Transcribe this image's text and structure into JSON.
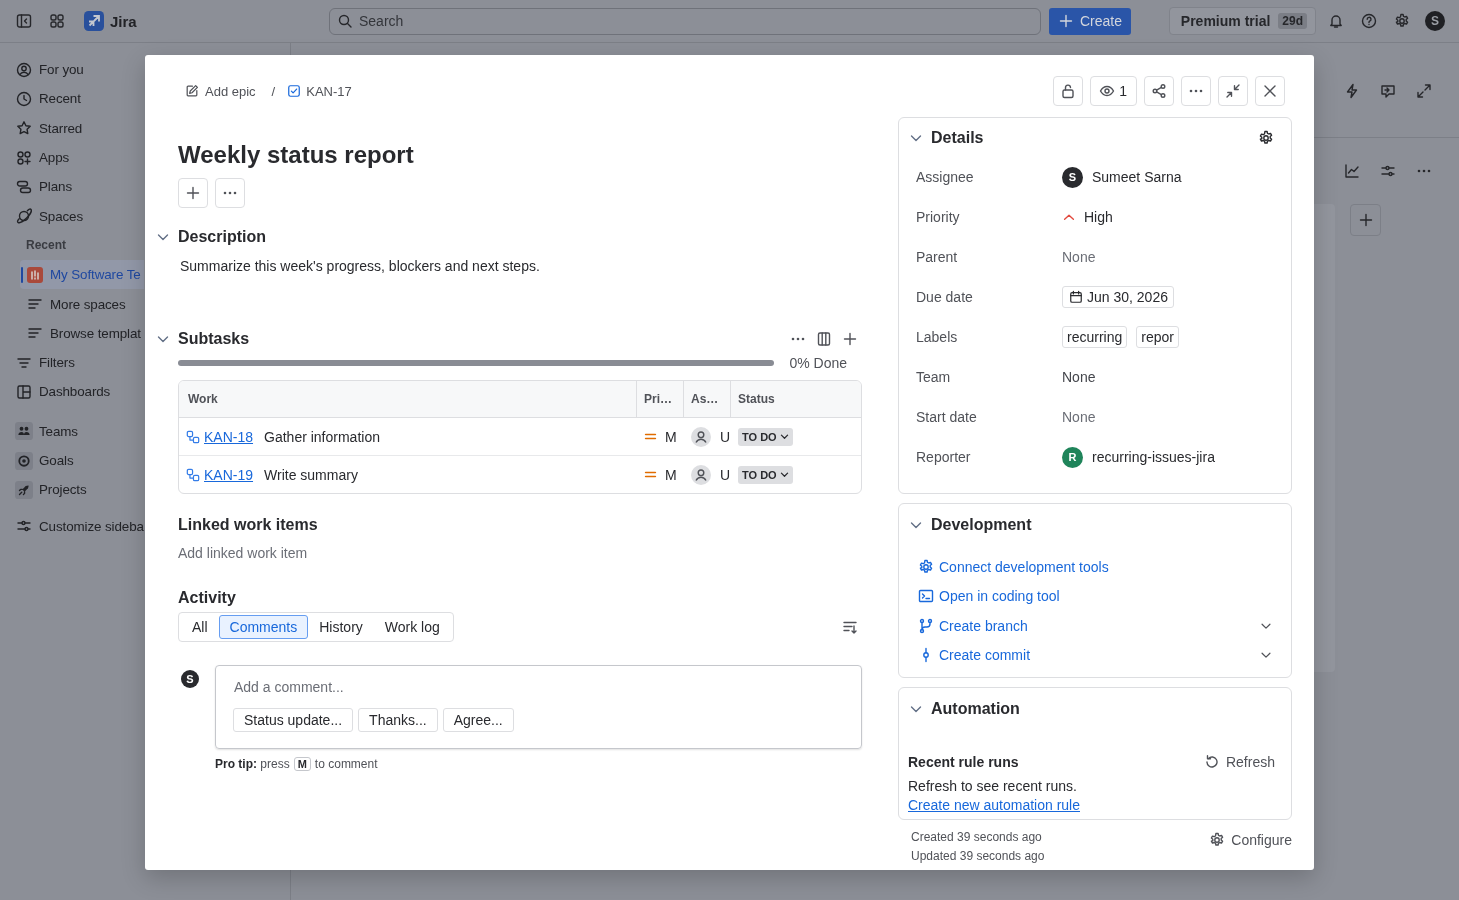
{
  "topbar": {
    "product": "Jira",
    "search": {
      "placeholder": "Search"
    },
    "create_button": "Create",
    "trial": {
      "label": "Premium trial",
      "badge": "29d"
    },
    "avatar": "S"
  },
  "sidebar": {
    "items": [
      {
        "label": "For you",
        "kind": "nav",
        "selected": false
      },
      {
        "label": "Recent",
        "kind": "nav",
        "selected": false
      },
      {
        "label": "Starred",
        "kind": "nav",
        "selected": false
      },
      {
        "label": "Apps",
        "kind": "nav",
        "selected": false
      },
      {
        "label": "Plans",
        "kind": "nav",
        "selected": false
      },
      {
        "label": "Spaces",
        "kind": "nav",
        "selected": false
      },
      {
        "label": "Recent",
        "kind": "section",
        "selected": false
      },
      {
        "label": "My Software Te",
        "kind": "project",
        "selected": true
      },
      {
        "label": "More spaces",
        "kind": "sub",
        "selected": false
      },
      {
        "label": "Browse templat",
        "kind": "sub",
        "selected": false
      },
      {
        "label": "Filters",
        "kind": "nav",
        "selected": false
      },
      {
        "label": "Dashboards",
        "kind": "nav",
        "selected": false
      },
      {
        "label": "Teams",
        "kind": "tile",
        "selected": false
      },
      {
        "label": "Goals",
        "kind": "tile",
        "selected": false
      },
      {
        "label": "Projects",
        "kind": "tile",
        "selected": false
      },
      {
        "label": "Customize sideba",
        "kind": "nav",
        "selected": false
      }
    ]
  },
  "modal": {
    "breadcrumbs": [
      {
        "label": "Add epic",
        "kind": "epic"
      },
      {
        "label": "KAN-17",
        "kind": "task"
      }
    ],
    "breadcrumb_separator": "/",
    "watchers": "1",
    "title": "Weekly status report",
    "description": {
      "heading": "Description",
      "expanded": true,
      "text": "Summarize this week's progress, blockers and next steps."
    },
    "subtasks": {
      "heading": "Subtasks",
      "expanded": true,
      "level": 0,
      "progress_label": "0% Done",
      "columns": [
        "Work",
        "Pri…",
        "As…",
        "Status"
      ],
      "rows": [
        {
          "key": "KAN-18",
          "summary": "Gather information",
          "priority": "M",
          "assignee": "U",
          "status": "TO DO"
        },
        {
          "key": "KAN-19",
          "summary": "Write summary",
          "priority": "M",
          "assignee": "U",
          "status": "TO DO"
        }
      ]
    },
    "linked_work_items": {
      "heading": "Linked work items",
      "action": "Add linked work item"
    },
    "activity": {
      "heading": "Activity",
      "tabs": [
        {
          "label": "All",
          "selected": false
        },
        {
          "label": "Comments",
          "selected": true
        },
        {
          "label": "History",
          "selected": false
        },
        {
          "label": "Work log",
          "selected": false
        }
      ],
      "avatar": "S",
      "comment_placeholder": "Add a comment...",
      "suggestions": [
        "Status update...",
        "Thanks...",
        "Agree..."
      ],
      "pro_tip": "**Pro tip:** press",
      "shortcut_key": "M",
      "pro_tip_end": "to comment"
    },
    "details": {
      "heading": "Details",
      "expanded": true,
      "fields": [
        {
          "label": "Assignee",
          "kind": "person",
          "avatar": "S",
          "color": "#292a2e",
          "value": "Sumeet Sarna"
        },
        {
          "label": "Priority",
          "kind": "priority",
          "value": "High"
        },
        {
          "label": "Parent",
          "kind": "empty",
          "value": "None"
        },
        {
          "label": "Due date",
          "kind": "date",
          "value": "Jun 30, 2026"
        },
        {
          "label": "Labels",
          "kind": "labels",
          "values": [
            "recurring",
            "repor"
          ]
        },
        {
          "label": "Team",
          "kind": "text",
          "value": "None"
        },
        {
          "label": "Start date",
          "kind": "empty",
          "value": "None"
        },
        {
          "label": "Reporter",
          "kind": "person",
          "avatar": "R",
          "color": "#1f845a",
          "value": "recurring-issues-jira"
        }
      ]
    },
    "development": {
      "heading": "Development",
      "expanded": true,
      "links": [
        {
          "label": "Connect development tools",
          "kind": "connect",
          "expandable": false
        },
        {
          "label": "Open in coding tool",
          "kind": "code",
          "expandable": false
        },
        {
          "label": "Create branch",
          "kind": "branch",
          "expandable": true
        },
        {
          "label": "Create commit",
          "kind": "commit",
          "expandable": true
        }
      ]
    },
    "automation": {
      "heading": "Automation",
      "expanded": true,
      "subheading": "Recent rule runs",
      "refresh_button": "Refresh",
      "message": "Refresh to see recent runs.",
      "link": "Create new automation rule"
    },
    "created": "Created 39 seconds ago",
    "updated": "Updated 39 seconds ago",
    "configure_button": "Configure"
  }
}
